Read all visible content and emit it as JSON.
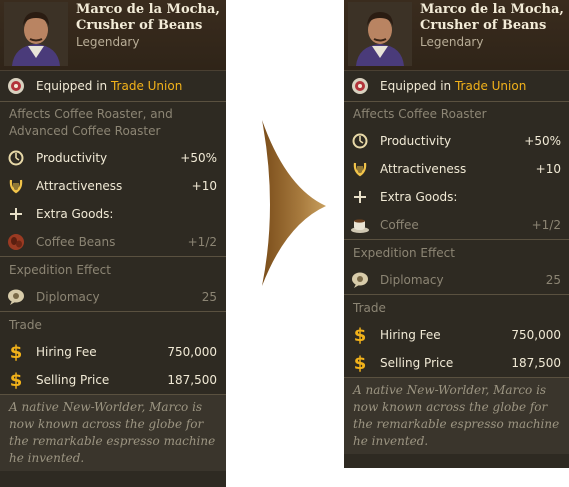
{
  "colors": {
    "panel": "#2e2a22",
    "accent": "#f2b21a",
    "dim": "#8c8574"
  },
  "left": {
    "name": "Marco de la Mocha, Crusher of Beans",
    "rarity": "Legendary",
    "equipped_prefix": "Equipped in",
    "equipped_place": "Trade Union",
    "affects": "Affects Coffee Roaster, and Advanced Coffee Roaster",
    "stats": [
      {
        "icon": "gear-icon",
        "label": "Productivity",
        "value": "+50%"
      },
      {
        "icon": "lyre-icon",
        "label": "Attractiveness",
        "value": "+10"
      }
    ],
    "extra_goods_label": "Extra Goods:",
    "extra_good": {
      "icon": "coffee-beans-icon",
      "label": "Coffee Beans",
      "value": "+1/2"
    },
    "expedition_title": "Expedition Effect",
    "expedition": {
      "icon": "speech-icon",
      "label": "Diplomacy",
      "value": "25"
    },
    "trade_title": "Trade",
    "hiring": {
      "label": "Hiring Fee",
      "value": "750,000"
    },
    "selling": {
      "label": "Selling Price",
      "value": "187,500"
    },
    "description": "A native New-Worlder, Marco is now known across the globe for the remarkable espresso machine he invented."
  },
  "right": {
    "name": "Marco de la Mocha, Crusher of Beans",
    "rarity": "Legendary",
    "equipped_prefix": "Equipped in",
    "equipped_place": "Trade Union",
    "affects": "Affects Coffee Roaster",
    "stats": [
      {
        "icon": "gear-icon",
        "label": "Productivity",
        "value": "+50%"
      },
      {
        "icon": "lyre-icon",
        "label": "Attractiveness",
        "value": "+10"
      }
    ],
    "extra_goods_label": "Extra Goods:",
    "extra_good": {
      "icon": "coffee-cup-icon",
      "label": "Coffee",
      "value": "+1/2"
    },
    "expedition_title": "Expedition Effect",
    "expedition": {
      "icon": "speech-icon",
      "label": "Diplomacy",
      "value": "25"
    },
    "trade_title": "Trade",
    "hiring": {
      "label": "Hiring Fee",
      "value": "750,000"
    },
    "selling": {
      "label": "Selling Price",
      "value": "187,500"
    },
    "description": "A native New-Worlder, Marco is now known across the globe for the remarkable espresso machine he invented."
  }
}
